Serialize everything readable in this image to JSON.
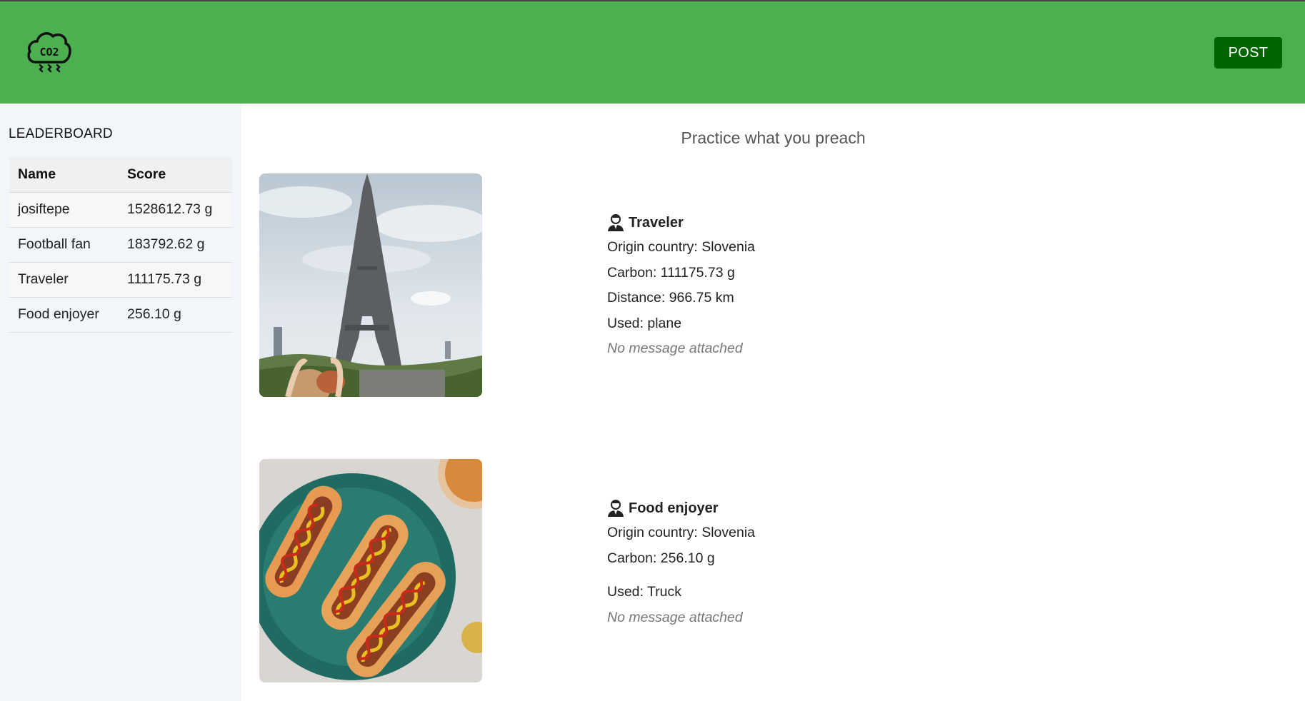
{
  "app": {
    "logo_text": "CO2",
    "post_button": "POST"
  },
  "sidebar": {
    "title": "LEADERBOARD",
    "columns": [
      "Name",
      "Score"
    ],
    "rows": [
      {
        "name": "josiftepe",
        "score": "1528612.73 g"
      },
      {
        "name": "Football fan",
        "score": "183792.62 g"
      },
      {
        "name": "Traveler",
        "score": "111175.73 g"
      },
      {
        "name": "Food enjoyer",
        "score": "256.10 g"
      }
    ]
  },
  "main": {
    "tagline": "Practice what you preach",
    "posts": [
      {
        "username": "Traveler",
        "origin": "Origin country: Slovenia",
        "carbon": "Carbon: 111175.73 g",
        "distance": "Distance: 966.75 km",
        "used": "Used: plane",
        "message": "No message attached",
        "image_subject": "eiffel-tower-photo"
      },
      {
        "username": "Food enjoyer",
        "origin": "Origin country: Slovenia",
        "carbon": "Carbon: 256.10 g",
        "used": "Used: Truck",
        "message": "No message attached",
        "image_subject": "hot-dogs-photo"
      }
    ]
  },
  "colors": {
    "header": "#4caf50",
    "post_button": "#006400",
    "sidebar": "#f2f5f9"
  }
}
